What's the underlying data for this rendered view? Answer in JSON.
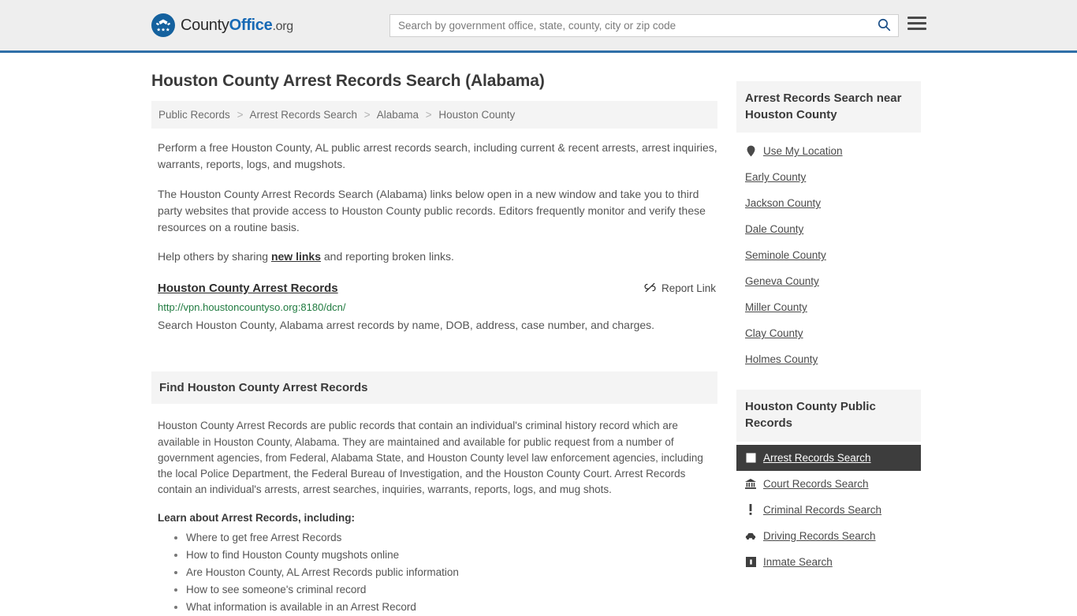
{
  "header": {
    "logo": {
      "icon": "eagle-seal-icon",
      "text_county": "County",
      "text_office": "Office",
      "text_org": ".org"
    },
    "search": {
      "placeholder": "Search by government office, state, county, city or zip code",
      "value": "",
      "icon": "search-icon"
    },
    "menu_icon": "hamburger-menu-icon",
    "border_color": "#2f6fa8",
    "background": "#eeeeee"
  },
  "main": {
    "title": "Houston County Arrest Records Search (Alabama)",
    "breadcrumb": [
      "Public Records",
      "Arrest Records Search",
      "Alabama",
      "Houston County"
    ],
    "breadcrumb_separator": ">",
    "paragraph1": "Perform a free Houston County, AL public arrest records search, including current & recent arrests, arrest inquiries, warrants, reports, logs, and mugshots.",
    "paragraph2": "The Houston County Arrest Records Search (Alabama) links below open in a new window and take you to third party websites that provide access to Houston County public records. Editors frequently monitor and verify these resources on a routine basis.",
    "paragraph3_pre": "Help others by sharing ",
    "paragraph3_link": "new links",
    "paragraph3_post": " and reporting broken links.",
    "result": {
      "title": "Houston County Arrest Records",
      "url": "http://vpn.houstoncountyso.org:8180/dcn/",
      "url_color": "#1f7a3f",
      "description": "Search Houston County, Alabama arrest records by name, DOB, address, case number, and charges.",
      "report_label": "Report Link",
      "report_icon": "broken-link-icon"
    },
    "find_section": {
      "heading": "Find Houston County Arrest Records",
      "body": "Houston County Arrest Records are public records that contain an individual's criminal history record which are available in Houston County, Alabama. They are maintained and available for public request from a number of government agencies, from Federal, Alabama State, and Houston County level law enforcement agencies, including the local Police Department, the Federal Bureau of Investigation, and the Houston County Court. Arrest Records contain an individual's arrests, arrest searches, inquiries, warrants, reports, logs, and mug shots.",
      "learn_heading": "Learn about Arrest Records, including:",
      "learn_items": [
        "Where to get free Arrest Records",
        "How to find Houston County mugshots online",
        "Are Houston County, AL Arrest Records public information",
        "How to see someone's criminal record",
        "What information is available in an Arrest Record"
      ]
    }
  },
  "sidebar": {
    "nearby": {
      "heading": "Arrest Records Search near Houston County",
      "items": [
        {
          "label": "Use My Location",
          "icon": "map-pin-icon"
        },
        {
          "label": "Early County",
          "icon": ""
        },
        {
          "label": "Jackson County",
          "icon": ""
        },
        {
          "label": "Dale County",
          "icon": ""
        },
        {
          "label": "Seminole County",
          "icon": ""
        },
        {
          "label": "Geneva County",
          "icon": ""
        },
        {
          "label": "Miller County",
          "icon": ""
        },
        {
          "label": "Clay County",
          "icon": ""
        },
        {
          "label": "Holmes County",
          "icon": ""
        }
      ]
    },
    "public_records": {
      "heading": "Houston County Public Records",
      "active_background": "#3d3d3d",
      "items": [
        {
          "label": "Arrest Records Search",
          "icon": "white-square-icon",
          "active": true
        },
        {
          "label": "Court Records Search",
          "icon": "courthouse-icon",
          "active": false
        },
        {
          "label": "Criminal Records Search",
          "icon": "exclamation-icon",
          "active": false
        },
        {
          "label": "Driving Records Search",
          "icon": "car-icon",
          "active": false
        },
        {
          "label": "Inmate Search",
          "icon": "jail-icon",
          "active": false
        }
      ]
    }
  }
}
